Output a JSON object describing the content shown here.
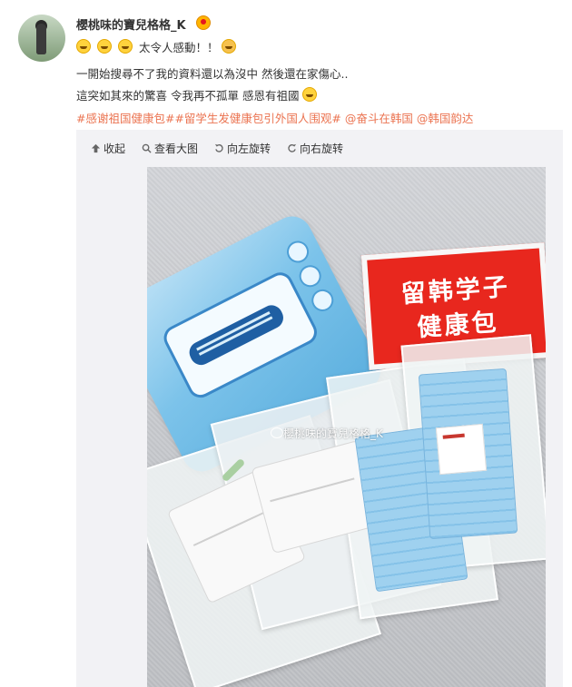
{
  "post": {
    "username": "櫻桃味的寶兒格格_K",
    "line1_text": "太令人感動！！",
    "line2": "一開始搜尋不了我的資料還以為沒中 然後還在家傷心..",
    "line3": "這突如其來的驚喜 令我再不孤單 感恩有祖國",
    "topics": [
      "#感谢祖国健康包#",
      "#留学生发健康包引外国人围观#"
    ],
    "mentions": [
      "@奋斗在韩国",
      "@韩国韵达"
    ]
  },
  "toolbar": {
    "collapse": "收起",
    "view_large": "查看大图",
    "rotate_left": "向左旋转",
    "rotate_right": "向右旋转"
  },
  "photo": {
    "red_label_line1": "留韩学子",
    "red_label_line2": "健康包",
    "watermark": "櫻桃味的寶兒格格_K"
  },
  "colors": {
    "topic": "#eb7350",
    "panel": "#f2f2f5",
    "red_label": "#e8271e"
  }
}
